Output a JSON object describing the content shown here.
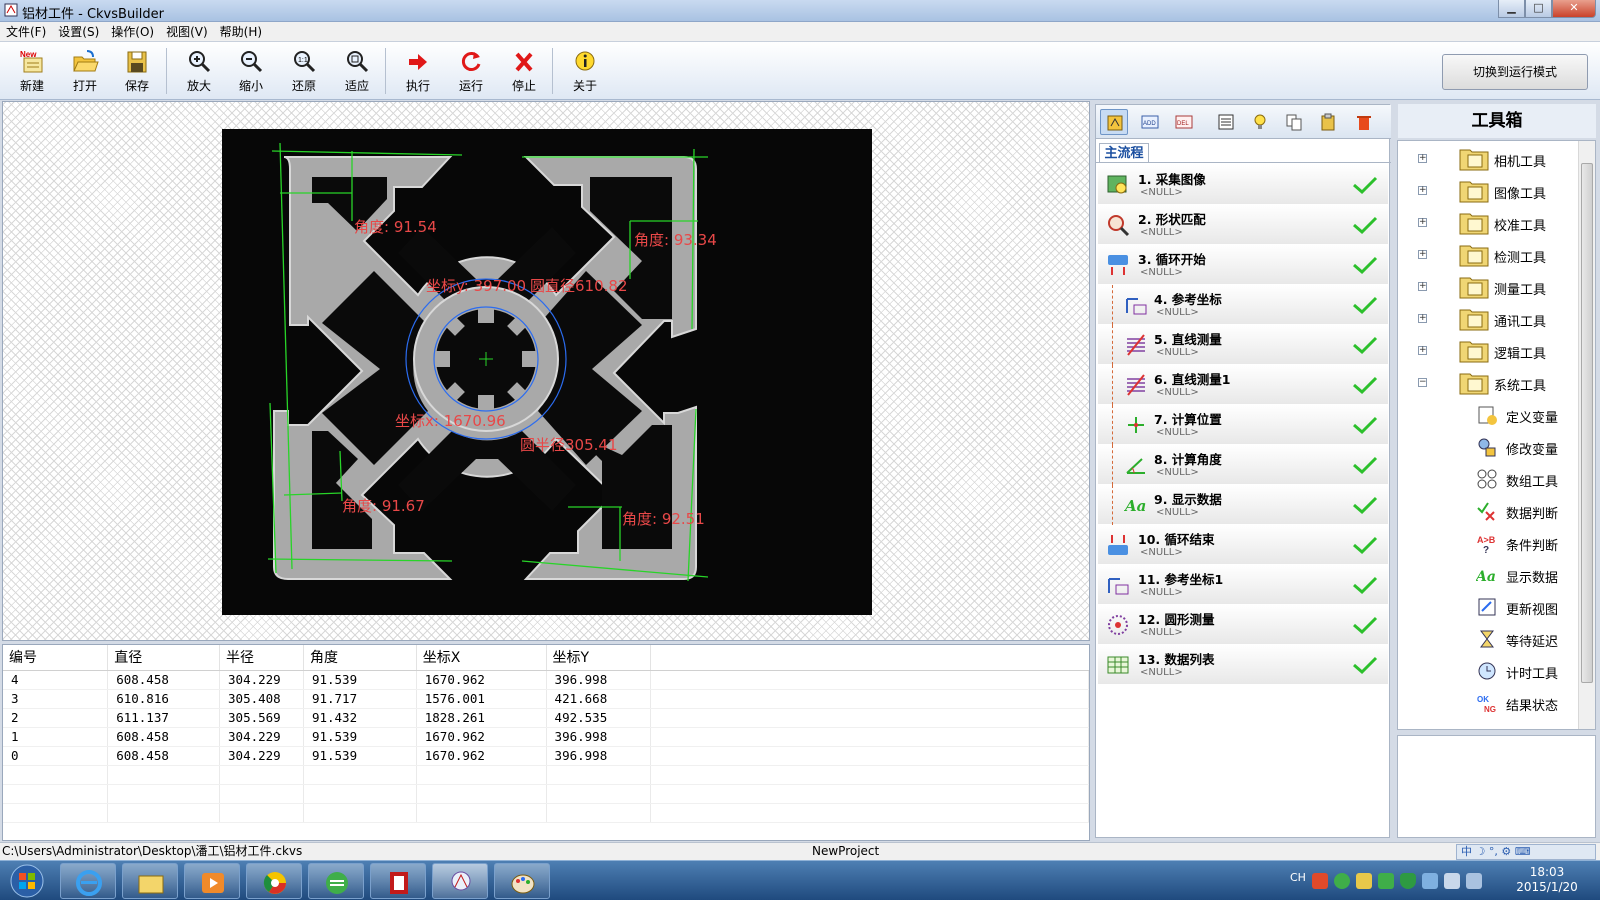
{
  "window": {
    "title": "铝材工件 - CkvsBuilder",
    "min": "▁",
    "max": "□",
    "close": "✕"
  },
  "menu": [
    "文件(F)",
    "设置(S)",
    "操作(O)",
    "视图(V)",
    "帮助(H)"
  ],
  "toolbar": {
    "new": "新建",
    "open": "打开",
    "save": "保存",
    "zoom_in": "放大",
    "zoom_out": "缩小",
    "restore": "还原",
    "fit": "适应",
    "execute": "执行",
    "run": "运行",
    "stop": "停止",
    "about": "关于",
    "new_badge": "New",
    "run_mode_button": "切换到运行模式"
  },
  "overlay": {
    "angle_tl": "角度: 91.54",
    "angle_tr": "角度: 93.34",
    "angle_bl": "角度: 91.67",
    "angle_br": "角度: 92.51",
    "coord_y": "坐标y: 397.00",
    "circle_diameter": "圆直径610.82",
    "coord_x": "坐标x: 1670.96",
    "circle_radius": "圆半径305.41"
  },
  "table": {
    "headers": [
      "编号",
      "直径",
      "半径",
      "角度",
      "坐标X",
      "坐标Y"
    ],
    "rows": [
      [
        "4",
        "608.458",
        "304.229",
        "91.539",
        "1670.962",
        "396.998"
      ],
      [
        "3",
        "610.816",
        "305.408",
        "91.717",
        "1576.001",
        "421.668"
      ],
      [
        "2",
        "611.137",
        "305.569",
        "91.432",
        "1828.261",
        "492.535"
      ],
      [
        "1",
        "608.458",
        "304.229",
        "91.539",
        "1670.962",
        "396.998"
      ],
      [
        "0",
        "608.458",
        "304.229",
        "91.539",
        "1670.962",
        "396.998"
      ]
    ]
  },
  "status": {
    "path": "C:\\Users\\Administrator\\Desktop\\潘工\\铝材工件.ckvs",
    "project": "NewProject",
    "ime": "中 ☽ °, ⚙ ⌨"
  },
  "flow": {
    "tab": "主流程",
    "steps": [
      {
        "name": "1. 采集图像",
        "param": "<NULL>"
      },
      {
        "name": "2. 形状匹配",
        "param": "<NULL>"
      },
      {
        "name": "3. 循环开始",
        "param": "<NULL>"
      },
      {
        "name": "4. 参考坐标",
        "param": "<NULL>"
      },
      {
        "name": "5. 直线测量",
        "param": "<NULL>"
      },
      {
        "name": "6. 直线测量1",
        "param": "<NULL>"
      },
      {
        "name": "7. 计算位置",
        "param": "<NULL>"
      },
      {
        "name": "8. 计算角度",
        "param": "<NULL>"
      },
      {
        "name": "9. 显示数据",
        "param": "<NULL>"
      },
      {
        "name": "10. 循环结束",
        "param": "<NULL>"
      },
      {
        "name": "11. 参考坐标1",
        "param": "<NULL>"
      },
      {
        "name": "12. 圆形测量",
        "param": "<NULL>"
      },
      {
        "name": "13. 数据列表",
        "param": "<NULL>"
      }
    ]
  },
  "toolbox": {
    "title": "工具箱",
    "categories": [
      "相机工具",
      "图像工具",
      "校准工具",
      "检测工具",
      "测量工具",
      "通讯工具",
      "逻辑工具",
      "系统工具"
    ],
    "system_children": [
      "定义变量",
      "修改变量",
      "数组工具",
      "数据判断",
      "条件判断",
      "显示数据",
      "更新视图",
      "等待延迟",
      "计时工具",
      "结果状态"
    ],
    "expand_plus": "+",
    "expand_minus": "−"
  },
  "taskbar": {
    "lang": "CH",
    "time": "18:03",
    "date": "2015/1/20"
  }
}
